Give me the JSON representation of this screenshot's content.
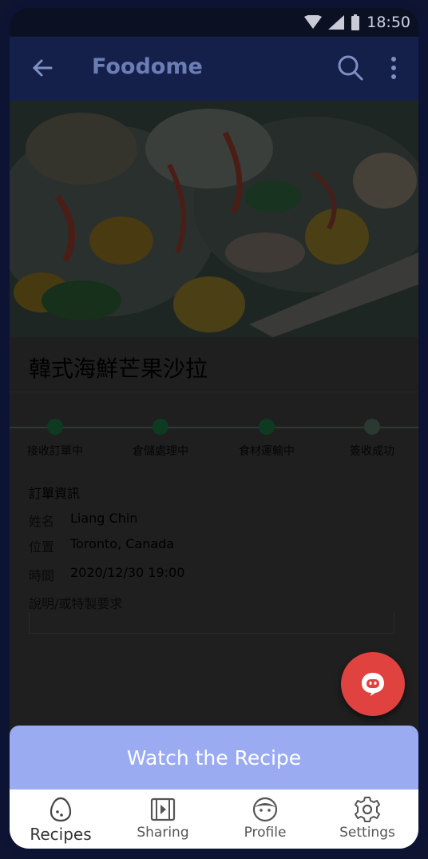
{
  "status": {
    "time": "18:50"
  },
  "appbar": {
    "title": "Foodome"
  },
  "recipe": {
    "title": "韓式海鮮芒果沙拉"
  },
  "progress": {
    "steps": [
      "接收訂單中",
      "倉儲處理中",
      "食材運輸中",
      "簽收成功"
    ]
  },
  "order": {
    "section_title": "訂單資訊",
    "name_label": "姓名",
    "name_value": "Liang Chin",
    "location_label": "位置",
    "location_value": "Toronto, Canada",
    "time_label": "時間",
    "time_value": "2020/12/30 19:00",
    "note_label": "說明/或特製要求",
    "note_value": ""
  },
  "actions": {
    "watch_label": "Watch the Recipe"
  },
  "nav": {
    "items": [
      {
        "label": "Recipes",
        "icon": "egg-icon"
      },
      {
        "label": "Sharing",
        "icon": "video-icon"
      },
      {
        "label": "Profile",
        "icon": "face-icon"
      },
      {
        "label": "Settings",
        "icon": "gear-icon"
      }
    ]
  },
  "colors": {
    "accent": "#9aabf1",
    "fab": "#e0423f",
    "appbar": "#14204a"
  }
}
